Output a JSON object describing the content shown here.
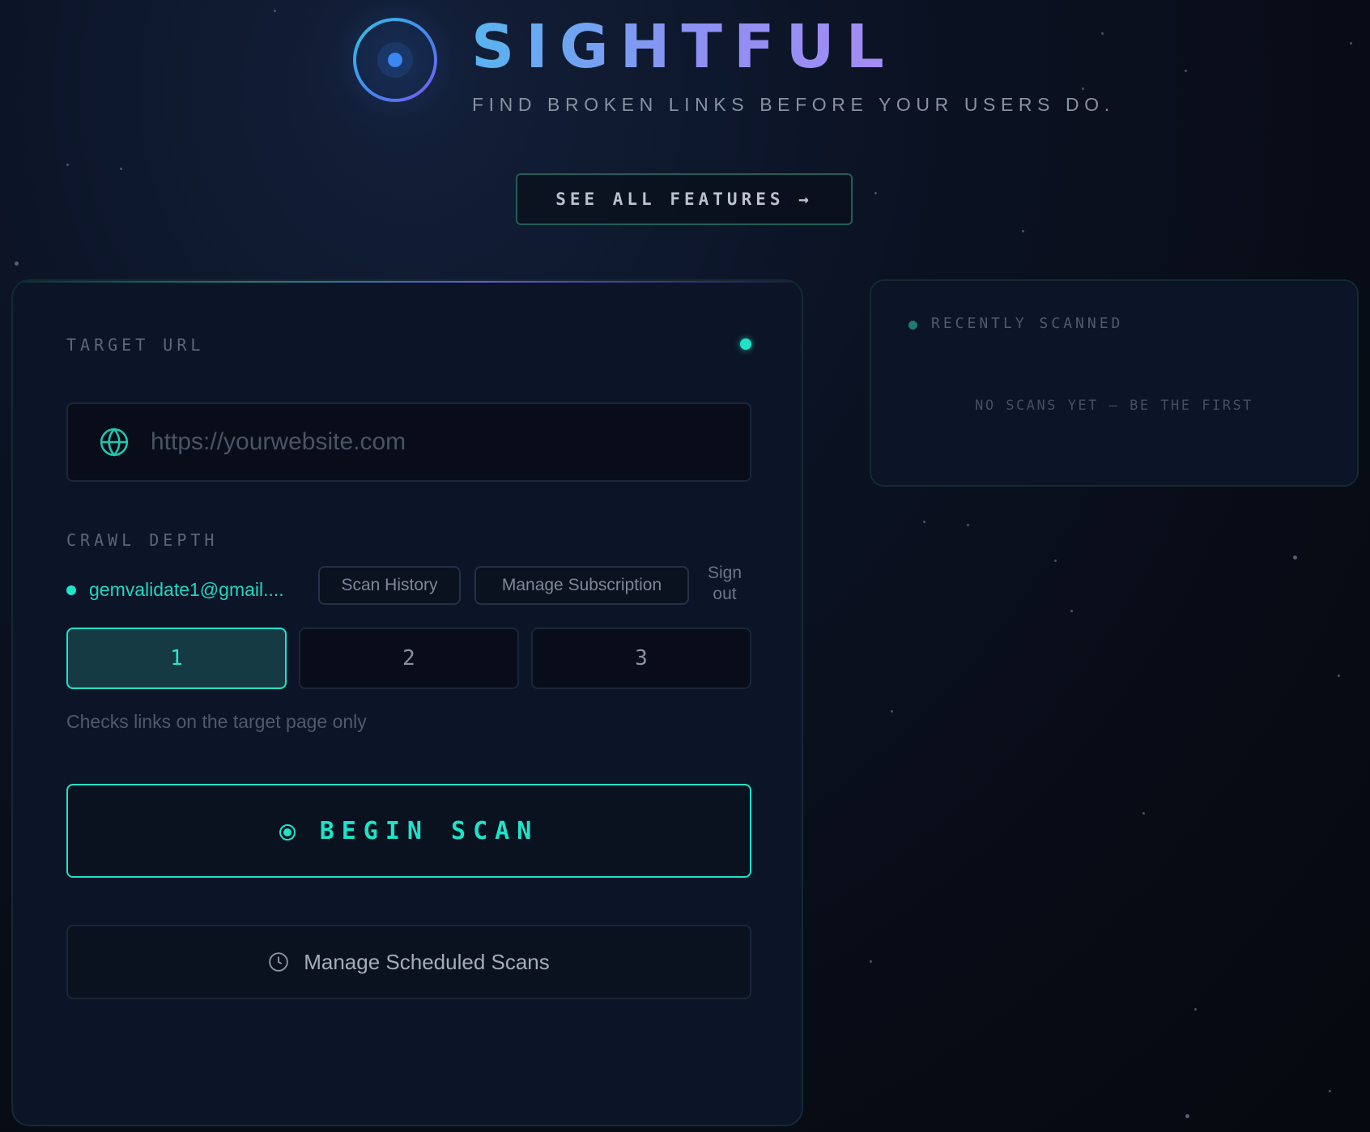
{
  "header": {
    "title": "SIGHTFUL",
    "tagline": "FIND BROKEN LINKS BEFORE YOUR USERS DO.",
    "features_label": "SEE ALL FEATURES →"
  },
  "main": {
    "target_url_label": "TARGET URL",
    "url_placeholder": "https://yourwebsite.com",
    "url_value": "",
    "crawl_depth_label": "CRAWL DEPTH",
    "user": {
      "email": "gemvalidate1@gmail....",
      "scan_history_label": "Scan History",
      "manage_subscription_label": "Manage Subscription",
      "sign_out_label": "Sign out"
    },
    "depth_options": [
      "1",
      "2",
      "3"
    ],
    "selected_depth": "1",
    "depth_hint": "Checks links on the target page only",
    "begin_scan_label": "BEGIN SCAN",
    "scheduled_label": "Manage Scheduled Scans"
  },
  "recent": {
    "title": "RECENTLY SCANNED",
    "empty_text": "NO SCANS YET — BE THE FIRST"
  },
  "icons": {
    "logo": "crosshair-icon",
    "url": "globe-icon",
    "scheduled": "clock-icon",
    "scan": "target-dot-icon"
  },
  "colors": {
    "accent": "#1ee3c8",
    "title_gradient_start": "#58b4f0",
    "title_gradient_end": "#a58cf5",
    "background": "#0b1324",
    "panel": "#0c1427"
  }
}
